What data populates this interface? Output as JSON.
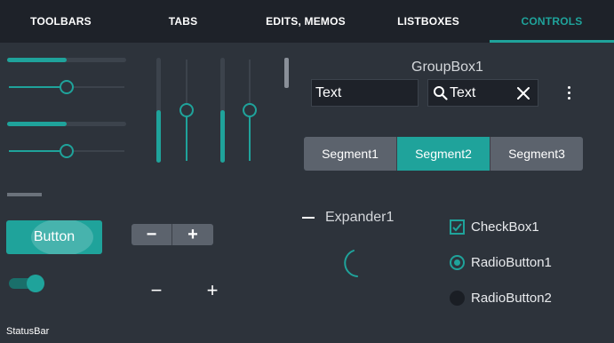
{
  "tabs": [
    {
      "label": "TOOLBARS",
      "active": false
    },
    {
      "label": "TABS",
      "active": false
    },
    {
      "label": "EDITS, MEMOS",
      "active": false
    },
    {
      "label": "LISTBOXES",
      "active": false
    },
    {
      "label": "CONTROLS",
      "active": true
    }
  ],
  "colors": {
    "accent": "#1fa39b",
    "background": "#2d333b",
    "tabbar": "#1e2229",
    "button_gray": "#5c636d"
  },
  "controls": {
    "progress_1": 0.5,
    "slider_1": 0.5,
    "progress_2": 0.5,
    "slider_2": 0.5,
    "vprogress_1": 0.5,
    "vslider_1": 0.5,
    "vprogress_2": 0.5,
    "vslider_2": 0.5,
    "button_label": "Button",
    "toggle_on": true,
    "stepper_minus": "−",
    "stepper_plus": "+",
    "minus_glyph": "−",
    "plus_glyph": "+"
  },
  "groupbox": {
    "title": "GroupBox1",
    "edit_value": "Text",
    "search_value": "Text",
    "search_icon": "search-icon",
    "clear_icon": "close-icon",
    "menu_icon": "more-vertical-icon"
  },
  "segments": [
    {
      "label": "Segment1",
      "active": false
    },
    {
      "label": "Segment2",
      "active": true
    },
    {
      "label": "Segment3",
      "active": false
    }
  ],
  "expander": {
    "label": "Expander1",
    "icon": "minus-icon"
  },
  "checkbox": {
    "label": "CheckBox1",
    "checked": true
  },
  "radios": [
    {
      "label": "RadioButton1",
      "checked": true
    },
    {
      "label": "RadioButton2",
      "checked": false
    }
  ],
  "statusbar": {
    "text": "StatusBar"
  }
}
